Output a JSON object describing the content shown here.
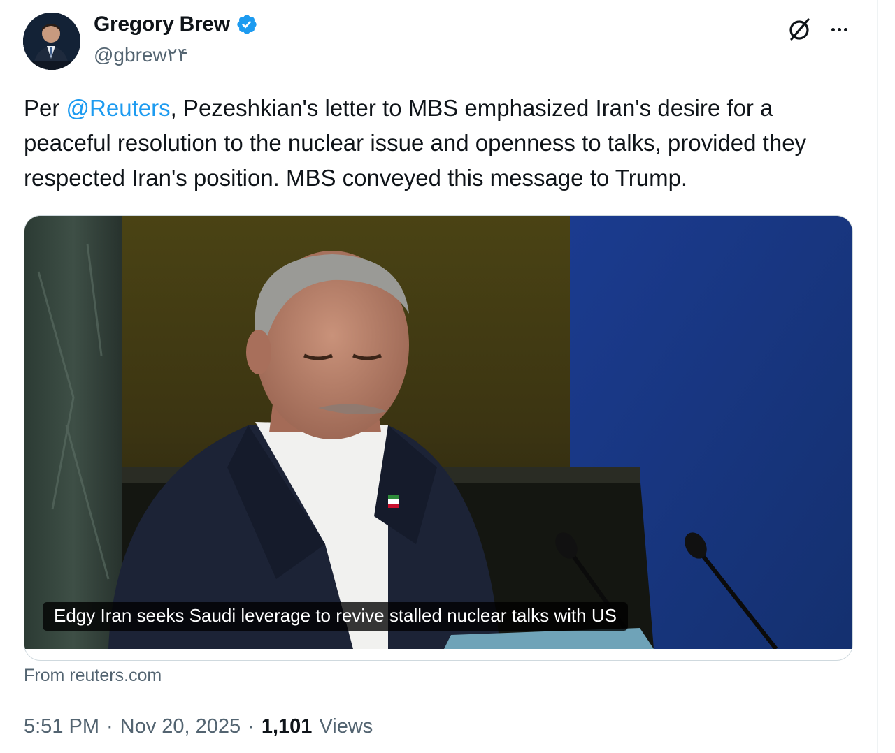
{
  "author": {
    "name": "Gregory Brew",
    "handle": "@gbrew۲۴",
    "verified": true,
    "avatar_icon": "person-avatar"
  },
  "actions": {
    "grok_icon": "grok-icon",
    "more_icon": "more-dots-icon"
  },
  "tweet": {
    "text_prefix": "Per ",
    "mention": "@Reuters",
    "text_rest": ", Pezeshkian's letter to MBS emphasized Iran's desire for a peaceful resolution to the nuclear issue and openness to talks, provided they respected Iran's position. MBS conveyed this message to Trump."
  },
  "card": {
    "caption": "Edgy Iran seeks Saudi leverage to revive stalled nuclear talks with US",
    "source": "From reuters.com"
  },
  "meta": {
    "time": "5:51 PM",
    "separator": "·",
    "date": "Nov 20, 2025",
    "views_count": "1,101",
    "views_label": "Views"
  },
  "colors": {
    "accent": "#1d9bf0",
    "text": "#0f1419",
    "secondary": "#536471",
    "border": "#cfd9de"
  }
}
